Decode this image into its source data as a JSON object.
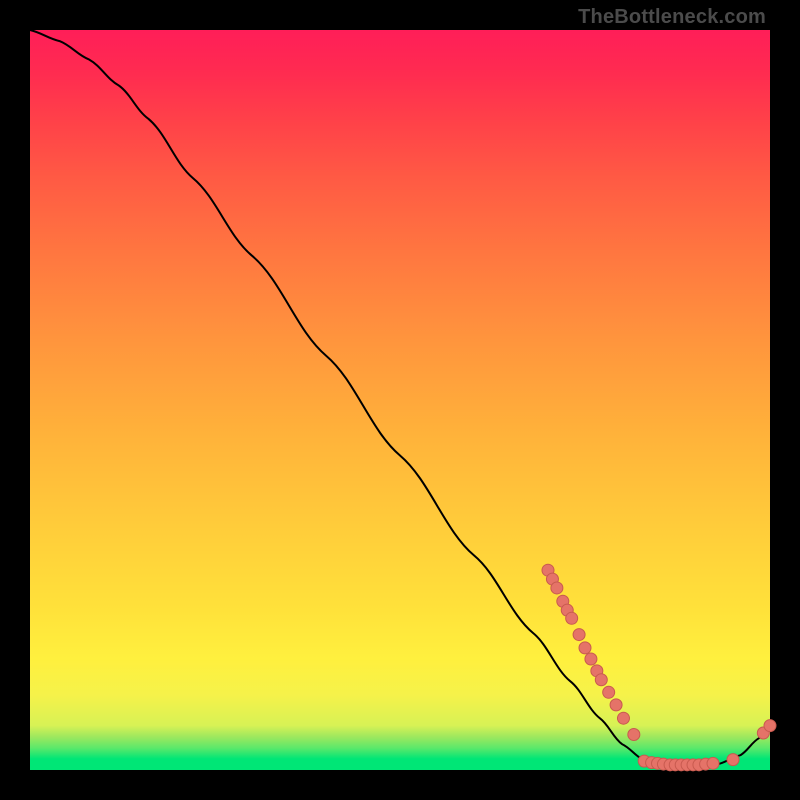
{
  "watermark": "TheBottleneck.com",
  "colors": {
    "marker_fill": "#e57368",
    "marker_stroke": "#c85a4f",
    "line": "#000000"
  },
  "chart_data": {
    "type": "line",
    "title": "",
    "xlabel": "",
    "ylabel": "",
    "xlim": [
      0,
      100
    ],
    "ylim": [
      0,
      100
    ],
    "grid": false,
    "curve": [
      {
        "x": 0.0,
        "y": 100.0
      },
      {
        "x": 4.0,
        "y": 98.5
      },
      {
        "x": 8.0,
        "y": 96.0
      },
      {
        "x": 12.0,
        "y": 92.5
      },
      {
        "x": 16.0,
        "y": 88.0
      },
      {
        "x": 22.0,
        "y": 80.0
      },
      {
        "x": 30.0,
        "y": 69.5
      },
      {
        "x": 40.0,
        "y": 56.0
      },
      {
        "x": 50.0,
        "y": 42.5
      },
      {
        "x": 60.0,
        "y": 29.0
      },
      {
        "x": 68.0,
        "y": 18.5
      },
      {
        "x": 73.0,
        "y": 12.0
      },
      {
        "x": 77.0,
        "y": 7.0
      },
      {
        "x": 80.0,
        "y": 3.5
      },
      {
        "x": 83.0,
        "y": 1.3
      },
      {
        "x": 86.0,
        "y": 0.6
      },
      {
        "x": 90.0,
        "y": 0.6
      },
      {
        "x": 93.0,
        "y": 0.8
      },
      {
        "x": 96.0,
        "y": 2.0
      },
      {
        "x": 98.5,
        "y": 4.3
      },
      {
        "x": 100.0,
        "y": 6.0
      }
    ],
    "markers": [
      {
        "x": 70.0,
        "y": 27.0
      },
      {
        "x": 70.6,
        "y": 25.8
      },
      {
        "x": 71.2,
        "y": 24.6
      },
      {
        "x": 72.0,
        "y": 22.8
      },
      {
        "x": 72.6,
        "y": 21.6
      },
      {
        "x": 73.2,
        "y": 20.5
      },
      {
        "x": 74.2,
        "y": 18.3
      },
      {
        "x": 75.0,
        "y": 16.5
      },
      {
        "x": 75.8,
        "y": 15.0
      },
      {
        "x": 76.6,
        "y": 13.4
      },
      {
        "x": 77.2,
        "y": 12.2
      },
      {
        "x": 78.2,
        "y": 10.5
      },
      {
        "x": 79.2,
        "y": 8.8
      },
      {
        "x": 80.2,
        "y": 7.0
      },
      {
        "x": 81.6,
        "y": 4.8
      },
      {
        "x": 83.0,
        "y": 1.2
      },
      {
        "x": 84.0,
        "y": 1.0
      },
      {
        "x": 84.8,
        "y": 0.9
      },
      {
        "x": 85.6,
        "y": 0.8
      },
      {
        "x": 86.5,
        "y": 0.7
      },
      {
        "x": 87.2,
        "y": 0.7
      },
      {
        "x": 88.0,
        "y": 0.7
      },
      {
        "x": 88.8,
        "y": 0.7
      },
      {
        "x": 89.6,
        "y": 0.7
      },
      {
        "x": 90.4,
        "y": 0.7
      },
      {
        "x": 91.3,
        "y": 0.8
      },
      {
        "x": 92.3,
        "y": 0.9
      },
      {
        "x": 95.0,
        "y": 1.4
      },
      {
        "x": 99.1,
        "y": 5.0
      },
      {
        "x": 100.0,
        "y": 6.0
      }
    ]
  }
}
